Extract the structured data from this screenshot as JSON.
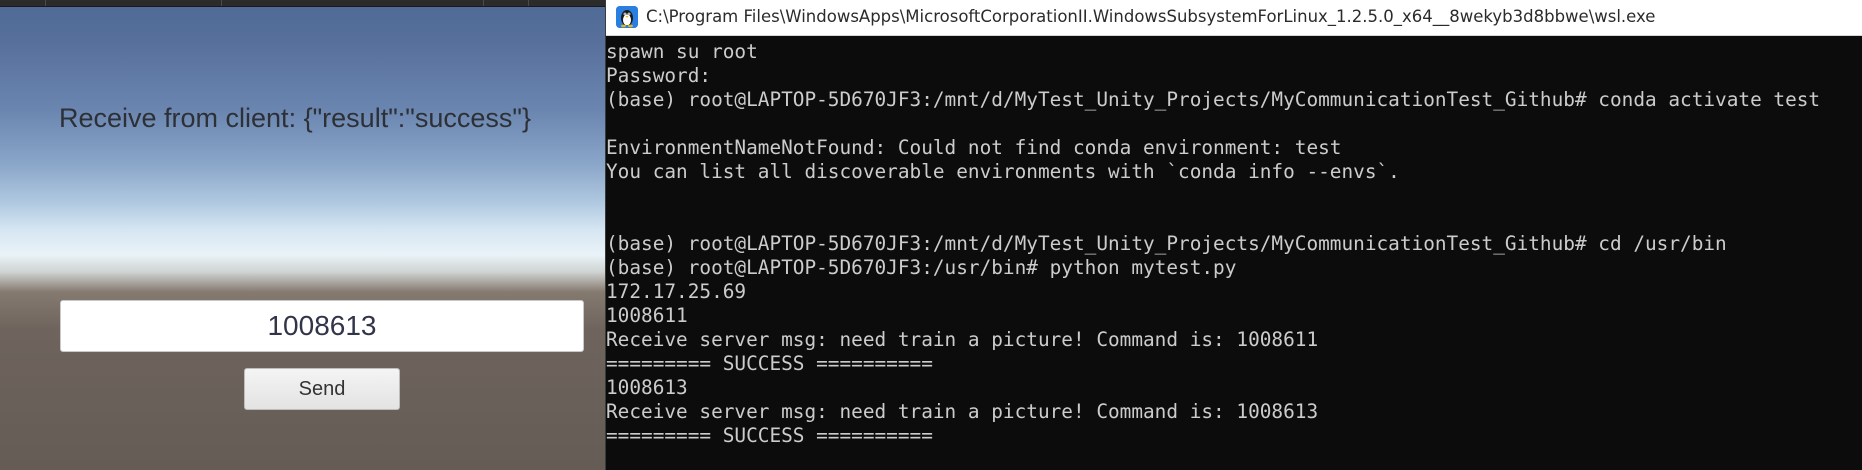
{
  "unity": {
    "receive_text": "Receive from client: {\"result\":\"success\"}",
    "command_input_value": "1008613",
    "send_label": "Send"
  },
  "console": {
    "title": "C:\\Program Files\\WindowsApps\\MicrosoftCorporationII.WindowsSubsystemForLinux_1.2.5.0_x64__8wekyb3d8bbwe\\wsl.exe",
    "icon": "tux-penguin-icon",
    "lines": [
      "spawn su root",
      "Password:",
      "(base) root@LAPTOP-5D670JF3:/mnt/d/MyTest_Unity_Projects/MyCommunicationTest_Github# conda activate test",
      "",
      "EnvironmentNameNotFound: Could not find conda environment: test",
      "You can list all discoverable environments with `conda info --envs`.",
      "",
      "",
      "(base) root@LAPTOP-5D670JF3:/mnt/d/MyTest_Unity_Projects/MyCommunicationTest_Github# cd /usr/bin",
      "(base) root@LAPTOP-5D670JF3:/usr/bin# python mytest.py",
      "172.17.25.69",
      "1008611",
      "Receive server msg: need train a picture! Command is: 1008611",
      "========= SUCCESS ==========",
      "1008613",
      "Receive server msg: need train a picture! Command is: 1008613",
      "========= SUCCESS =========="
    ]
  },
  "colors": {
    "terminal_bg": "#0c0c0c",
    "terminal_fg": "#cccccc",
    "titlebar_bg": "#ffffff"
  }
}
